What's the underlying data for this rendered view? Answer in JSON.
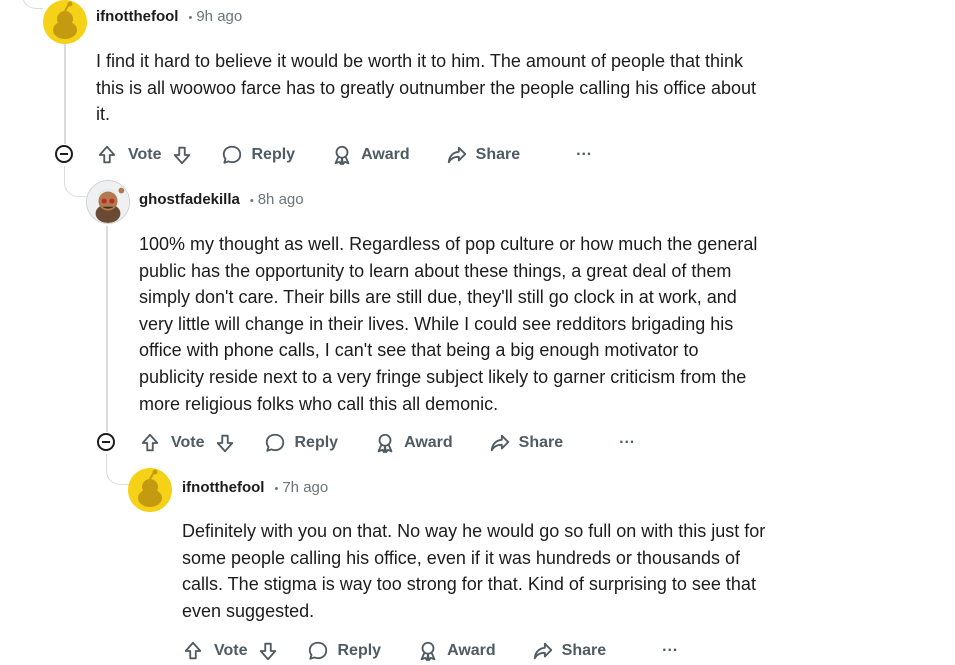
{
  "comments": [
    {
      "username": "ifnotthefool",
      "time": "9h ago",
      "body": "I find it hard to believe it would be worth it to him. The amount of people that think this is all woowoo farce has to greatly outnumber the people calling his office about it."
    },
    {
      "username": "ghostfadekilla",
      "time": "8h ago",
      "body": "100% my thought as well. Regardless of pop culture or how much the general public has the opportunity to learn about these things, a great deal of them simply don't care. Their bills are still due, they'll still go clock in at work, and very little will change in their lives. While I could see redditors brigading his office with phone calls, I can't see that being a big enough motivator to publicity reside next to a very fringe subject likely to garner criticism from the more religious folks who call this all demonic."
    },
    {
      "username": "ifnotthefool",
      "time": "7h ago",
      "body": "Definitely with you on that. No way he would go so full on with this just for some people calling his office, even if it was hundreds or thousands of calls. The stigma is way too strong for that. Kind of surprising to see that even suggested."
    }
  ],
  "actions": {
    "vote": "Vote",
    "reply": "Reply",
    "award": "Award",
    "share": "Share",
    "more": "···"
  },
  "separator": "•",
  "icons": [
    "upvote-icon",
    "downvote-icon",
    "reply-icon",
    "award-icon",
    "share-icon",
    "more-icon",
    "collapse-icon",
    "snoo-avatar-icon"
  ],
  "colors": {
    "avatar_yellow": "#f5d218",
    "meta_gray": "#6b7478",
    "action_gray": "#4f5b62",
    "thread_line": "#d9dde0"
  }
}
